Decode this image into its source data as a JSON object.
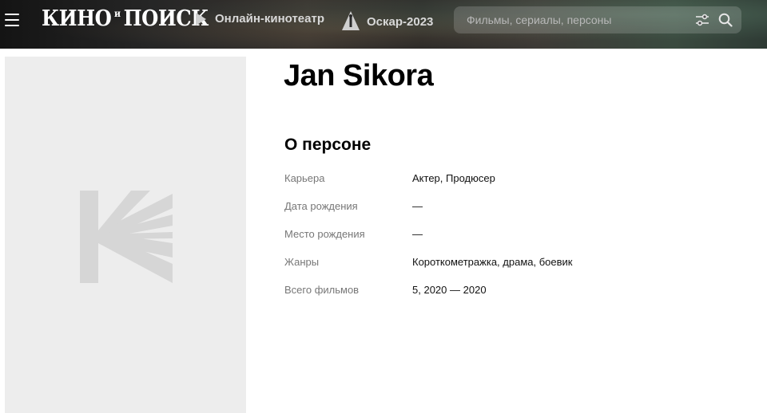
{
  "header": {
    "logo_main_1": "КИНО",
    "logo_small": "и",
    "logo_main_2": "ПОИСК",
    "nav_online": "Онлайн-кинотеатр",
    "nav_oscar": "Оскар-2023",
    "search_placeholder": "Фильмы, сериалы, персоны"
  },
  "person": {
    "name": "Jan Sikora"
  },
  "about": {
    "title": "О персоне",
    "rows": [
      {
        "label": "Карьера",
        "value_parts": [
          "Актер",
          ", ",
          "Продюсер"
        ]
      },
      {
        "label": "Дата рождения",
        "value": "—"
      },
      {
        "label": "Место рождения",
        "value": "—"
      },
      {
        "label": "Жанры",
        "value_parts": [
          "Короткометражка",
          ", ",
          "драма",
          ", ",
          "боевик"
        ]
      },
      {
        "label": "Всего фильмов",
        "value_parts": [
          "5",
          ", ",
          "2020",
          " — ",
          "2020"
        ]
      }
    ]
  },
  "colors": {
    "poster_bg": "#ededed",
    "poster_logo": "#d6d6d6",
    "label_gray": "#777777"
  }
}
